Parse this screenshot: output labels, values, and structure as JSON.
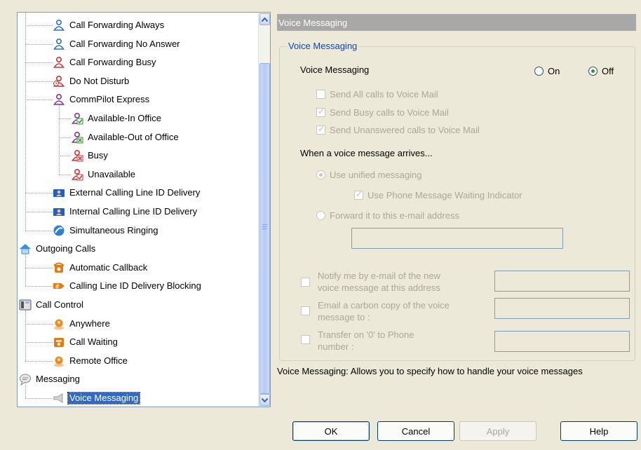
{
  "tree": {
    "items": [
      {
        "label": "Call Forwarding Always",
        "icon": "person-forward-icon",
        "color": "#2a6fd0"
      },
      {
        "label": "Call Forwarding No Answer",
        "icon": "person-forward-icon",
        "color": "#2a6fd0"
      },
      {
        "label": "Call Forwarding Busy",
        "icon": "person-forward-icon",
        "color": "#d03030"
      },
      {
        "label": "Do Not Disturb",
        "icon": "person-dnd-icon",
        "color": "#d03030"
      },
      {
        "label": "CommPilot Express",
        "icon": "person-express-icon",
        "color": "#8a2f9c"
      },
      {
        "label": "Available-In Office",
        "icon": "person-check-icon",
        "color": "#8a2f9c"
      },
      {
        "label": "Available-Out of Office",
        "icon": "person-cross-icon",
        "color": "#8a2f9c"
      },
      {
        "label": "Busy",
        "icon": "person-busy-icon",
        "color": "#d03030"
      },
      {
        "label": "Unavailable",
        "icon": "person-unavailable-icon",
        "color": "#d03030"
      },
      {
        "label": "External Calling Line ID Delivery",
        "icon": "caller-id-icon",
        "color": "#1f5fbf"
      },
      {
        "label": "Internal Calling Line ID Delivery",
        "icon": "caller-id-icon",
        "color": "#1f5fbf"
      },
      {
        "label": "Simultaneous Ringing",
        "icon": "ring-globe-icon",
        "color": "#2f7fd8"
      },
      {
        "label": "Outgoing Calls",
        "icon": "house-icon",
        "color": "#3c8fe0"
      },
      {
        "label": "Automatic Callback",
        "icon": "phone-callback-icon",
        "color": "#e07b1a"
      },
      {
        "label": "Calling Line ID Delivery Blocking",
        "icon": "hash-block-icon",
        "color": "#e07b1a"
      },
      {
        "label": "Call Control",
        "icon": "desk-phone-icon",
        "color": "#555555"
      },
      {
        "label": "Anywhere",
        "icon": "orange-person-icon",
        "color": "#f08a1c"
      },
      {
        "label": "Call Waiting",
        "icon": "phone-waiting-icon",
        "color": "#e07b1a"
      },
      {
        "label": "Remote Office",
        "icon": "orange-person-icon",
        "color": "#f08a1c"
      },
      {
        "label": "Messaging",
        "icon": "speech-bubble-icon",
        "color": "#888888"
      },
      {
        "label": "Voice Messaging",
        "icon": "megaphone-icon",
        "color": "#9a9a9a"
      }
    ]
  },
  "panel": {
    "title": "Voice Messaging",
    "group_title": "Voice Messaging",
    "vm_label": "Voice Messaging",
    "on_label": "On",
    "off_label": "Off",
    "send_all": "Send All calls to Voice Mail",
    "send_busy": "Send Busy calls to Voice Mail",
    "send_unanswered": "Send Unanswered calls to Voice Mail",
    "when_arrives": "When a voice message arrives...",
    "use_unified": "Use unified messaging",
    "use_mwi": "Use Phone Message Waiting Indicator",
    "forward_email": "Forward it to this e-mail address",
    "notify_l1": "Notify me by e-mail of the new",
    "notify_l2": "voice message at this address",
    "cc_l1": "Email a carbon copy of the voice",
    "cc_l2": "message to :",
    "transfer_l1": "Transfer on '0' to Phone",
    "transfer_l2": "number :"
  },
  "status": "Voice Messaging: Allows you to specify how to handle your voice messages",
  "buttons": {
    "ok": "OK",
    "cancel": "Cancel",
    "apply": "Apply",
    "help": "Help"
  },
  "colors": {
    "selection": "#316ac5",
    "group_title": "#0046d5",
    "disabled_text": "#a8a89a"
  }
}
